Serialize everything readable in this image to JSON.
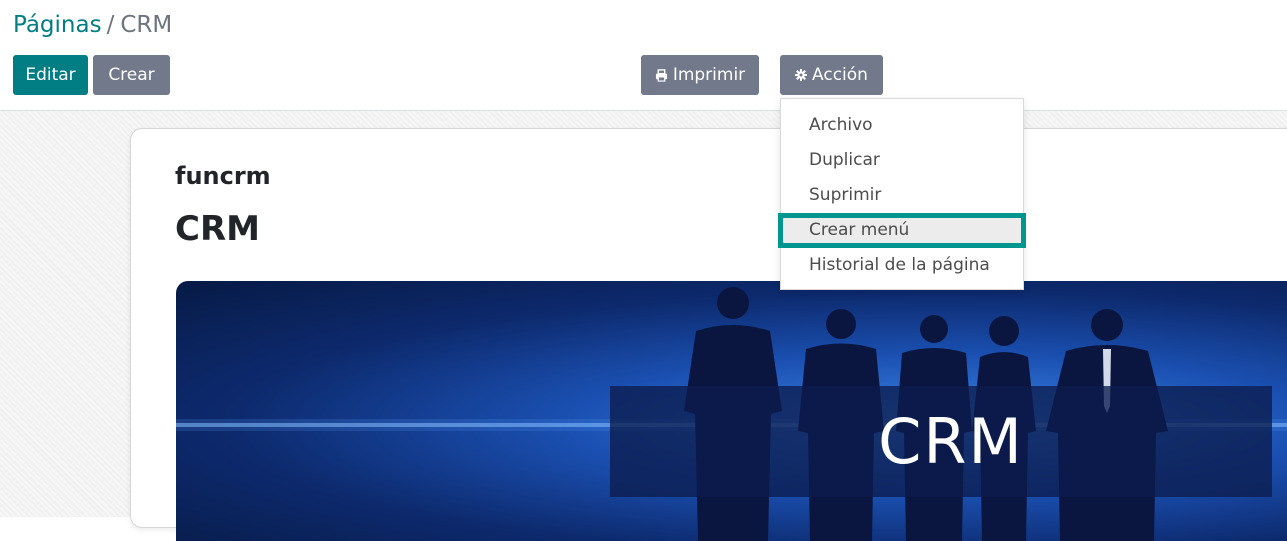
{
  "breadcrumb": {
    "parent": "Páginas",
    "separator": "/",
    "current": "CRM"
  },
  "toolbar": {
    "edit_label": "Editar",
    "create_label": "Crear",
    "print_label": "Imprimir",
    "action_label": "Acción"
  },
  "action_menu": {
    "items": [
      {
        "label": "Archivo"
      },
      {
        "label": "Duplicar"
      },
      {
        "label": "Suprimir"
      },
      {
        "label": "Crear menú"
      },
      {
        "label": "Historial de la página"
      }
    ],
    "highlighted_item": "Crear menú"
  },
  "record": {
    "slug": "funcrm",
    "title": "CRM",
    "banner_text": "CRM"
  },
  "colors": {
    "primary": "#017e84",
    "secondary": "#71798a",
    "highlight_border": "#00968f"
  },
  "icons": {
    "print": "print-icon",
    "action": "gear-icon"
  }
}
